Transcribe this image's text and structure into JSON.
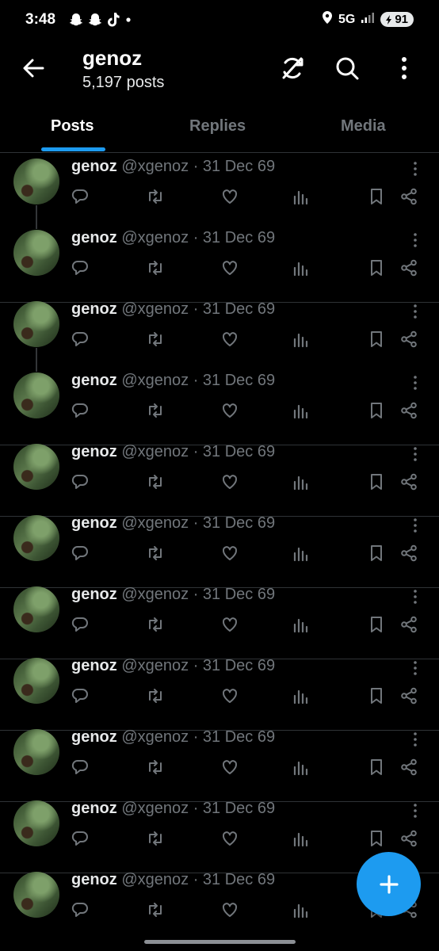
{
  "status_bar": {
    "time": "3:48",
    "network": "5G",
    "battery": "91",
    "left_icons": [
      "snapchat-icon",
      "snapchat-icon",
      "tiktok-icon",
      "dot-icon"
    ],
    "right_icons": [
      "location-icon",
      "signal-icon",
      "battery-icon"
    ]
  },
  "header": {
    "title": "genoz",
    "subtitle": "5,197 posts",
    "icons": [
      "back-arrow-icon",
      "sync-off-icon",
      "search-icon",
      "more-vertical-icon"
    ]
  },
  "tabs": [
    {
      "label": "Posts",
      "active": true
    },
    {
      "label": "Replies",
      "active": false
    },
    {
      "label": "Media",
      "active": false
    }
  ],
  "posts": [
    {
      "name": "genoz",
      "handle": "@xgenoz",
      "date": "· 31 Dec 69"
    },
    {
      "name": "genoz",
      "handle": "@xgenoz",
      "date": "· 31 Dec 69"
    },
    {
      "name": "genoz",
      "handle": "@xgenoz",
      "date": "· 31 Dec 69"
    },
    {
      "name": "genoz",
      "handle": "@xgenoz",
      "date": "· 31 Dec 69"
    },
    {
      "name": "genoz",
      "handle": "@xgenoz",
      "date": "· 31 Dec 69"
    },
    {
      "name": "genoz",
      "handle": "@xgenoz",
      "date": "· 31 Dec 69"
    },
    {
      "name": "genoz",
      "handle": "@xgenoz",
      "date": "· 31 Dec 69"
    },
    {
      "name": "genoz",
      "handle": "@xgenoz",
      "date": "· 31 Dec 69"
    },
    {
      "name": "genoz",
      "handle": "@xgenoz",
      "date": "· 31 Dec 69"
    },
    {
      "name": "genoz",
      "handle": "@xgenoz",
      "date": "· 31 Dec 69"
    },
    {
      "name": "genoz",
      "handle": "@xgenoz",
      "date": "· 31 Dec 69"
    }
  ],
  "post_actions": [
    "reply-icon",
    "repost-icon",
    "like-icon",
    "views-icon",
    "bookmark-icon",
    "share-icon"
  ],
  "fab": {
    "icon": "plus-icon"
  },
  "colors": {
    "accent": "#1d9bf0",
    "background": "#000000",
    "text": "#e7e9ea",
    "secondary": "#71767b"
  }
}
